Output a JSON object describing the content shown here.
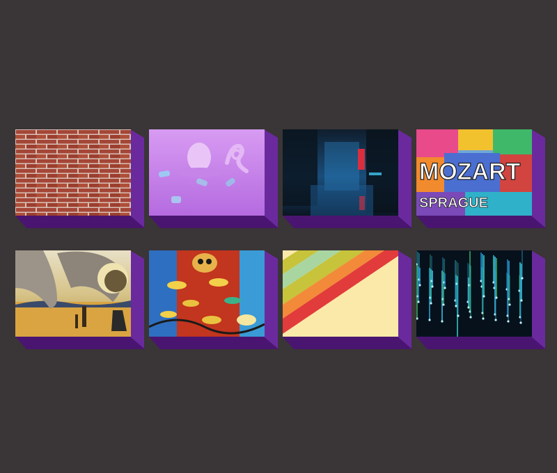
{
  "gallery": {
    "tiles": [
      {
        "name": "brick-wall-image",
        "accent": "#b5523b"
      },
      {
        "name": "pink-head-sculpture-image",
        "accent": "#c87ee8"
      },
      {
        "name": "rainy-city-street-image",
        "accent": "#1a4d7a"
      },
      {
        "name": "prague-graffiti-wall-image",
        "accent": "#f2c12e"
      },
      {
        "name": "surreal-desert-painting-image",
        "accent": "#d9a441"
      },
      {
        "name": "fish-graffiti-mural-image",
        "accent": "#d2401f"
      },
      {
        "name": "diagonal-stripes-image",
        "accent": "#fbe9a9"
      },
      {
        "name": "digital-rain-lights-image",
        "accent": "#2aa7d9"
      }
    ],
    "extrusion_colors": {
      "side": "#6a2a9e",
      "bottom": "#4a1570"
    },
    "background": "#3a3536",
    "graffiti_text": {
      "line1": "MOZART",
      "line2": "SPRAGUE"
    }
  }
}
